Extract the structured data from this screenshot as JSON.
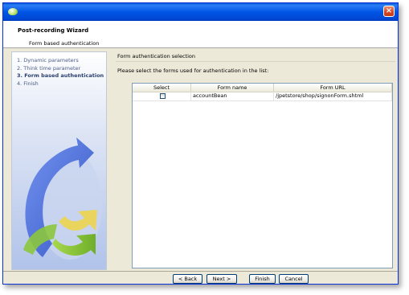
{
  "window": {
    "title": ""
  },
  "header": {
    "title": "Post-recording Wizard",
    "subtitle": "Form based authentication"
  },
  "sidebar": {
    "steps": [
      {
        "label": "1. Dynamic parameters",
        "active": false
      },
      {
        "label": "2. Think time parameter",
        "active": false
      },
      {
        "label": "3. Form based authentication",
        "active": true
      },
      {
        "label": "4. Finish",
        "active": false
      }
    ]
  },
  "main": {
    "section_title": "Form authentication selection",
    "instructions": "Please select the forms used for authentication in the list:",
    "table": {
      "headers": [
        "Select",
        "Form name",
        "Form URL"
      ],
      "rows": [
        {
          "selected": false,
          "form_name": "accountBean",
          "form_url": "/jpetstore/shop/signonForm.shtml"
        }
      ]
    }
  },
  "buttons": {
    "back": "< Back",
    "next": "Next >",
    "finish": "Finish",
    "cancel": "Cancel"
  },
  "icons": [
    "app-icon",
    "close-icon",
    "wizard-graphic"
  ],
  "colors": {
    "titlebar": "#0055e5",
    "sidebar_gradient_end": "#b1c3ea",
    "arrow_blue": "#3a62d6",
    "arrow_green": "#8cc63e",
    "arrow_yellow": "#ecd54e"
  }
}
